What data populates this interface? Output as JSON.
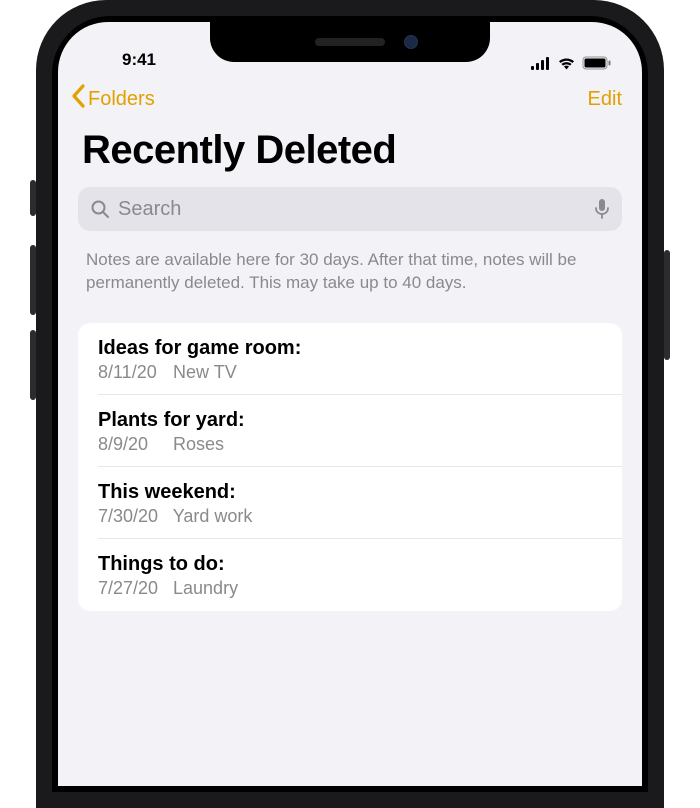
{
  "status": {
    "time": "9:41"
  },
  "nav": {
    "back_label": "Folders",
    "edit_label": "Edit"
  },
  "title": "Recently Deleted",
  "search": {
    "placeholder": "Search"
  },
  "info": "Notes are available here for 30 days. After that time, notes will be permanently deleted. This may take up to 40 days.",
  "notes": [
    {
      "title": "Ideas for game room:",
      "date": "8/11/20",
      "preview": "New TV"
    },
    {
      "title": "Plants for yard:",
      "date": "8/9/20",
      "preview": "Roses"
    },
    {
      "title": "This weekend:",
      "date": "7/30/20",
      "preview": "Yard work"
    },
    {
      "title": "Things to do:",
      "date": "7/27/20",
      "preview": "Laundry"
    }
  ]
}
